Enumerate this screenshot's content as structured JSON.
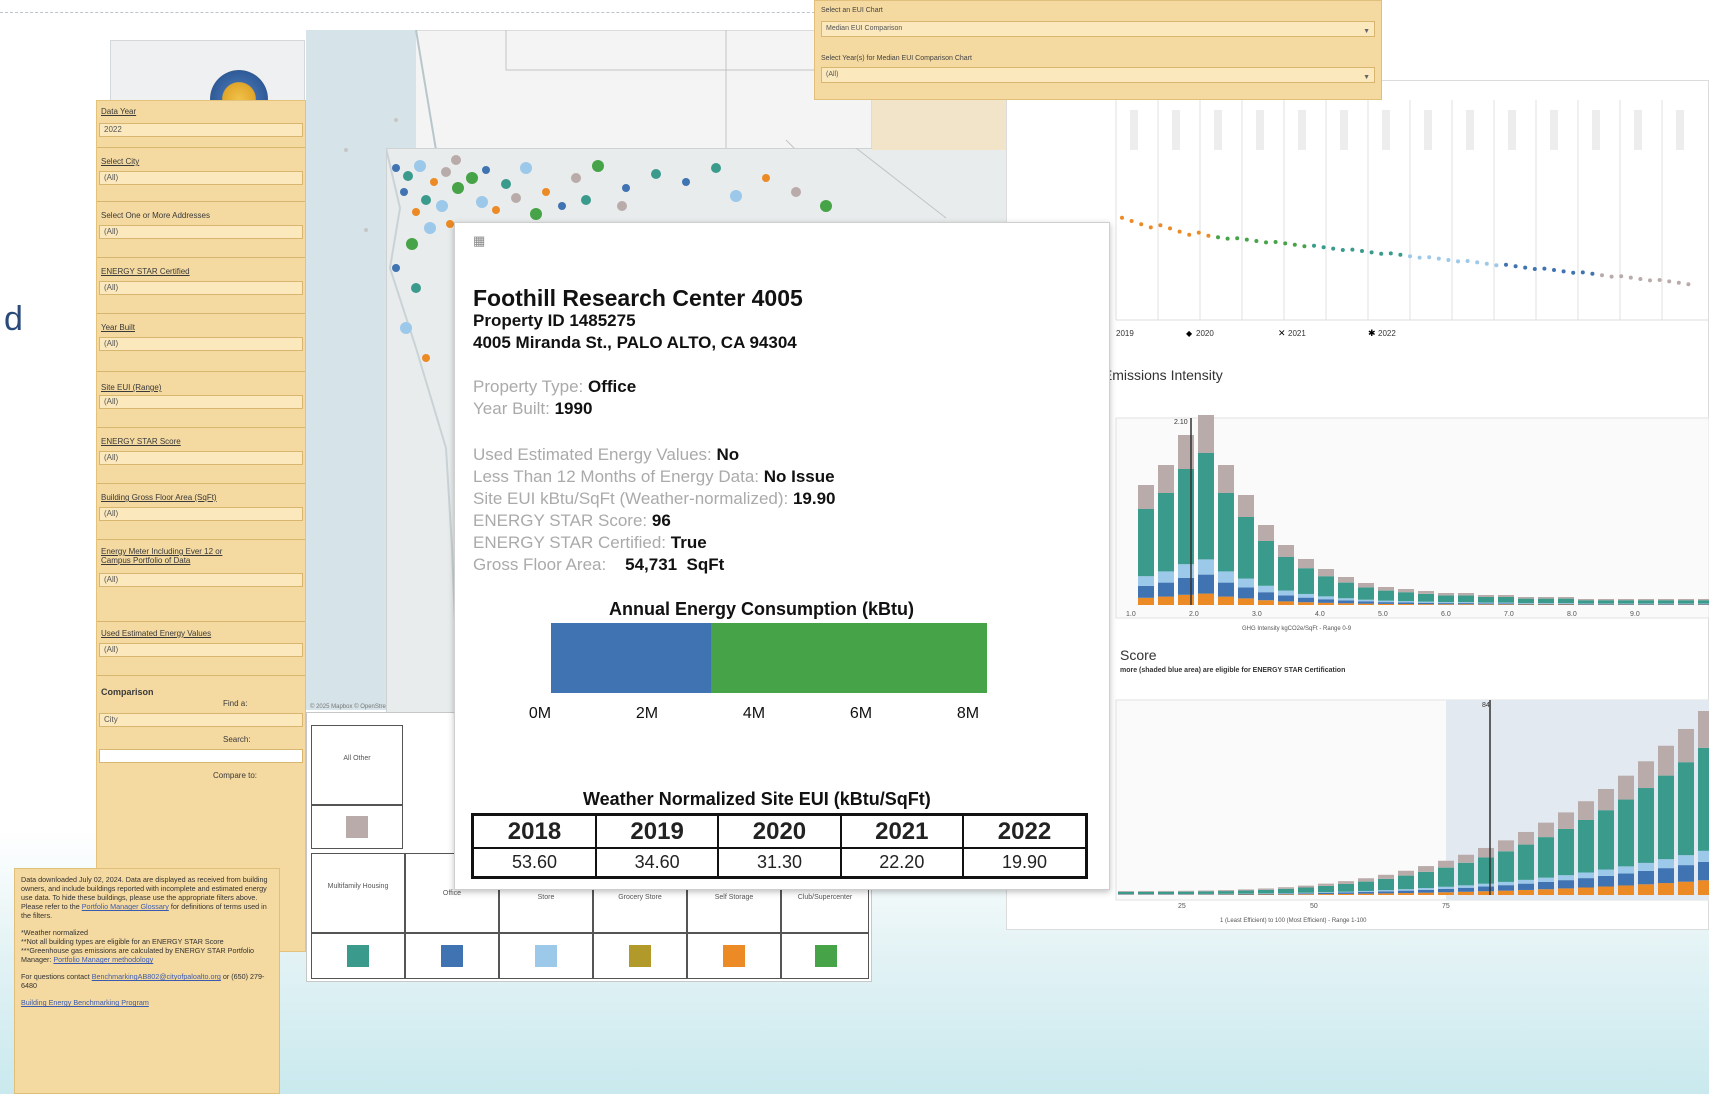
{
  "page_fragment": "d",
  "filters": {
    "items": [
      {
        "label": "Data Year",
        "value": "2022"
      },
      {
        "label": "Select City",
        "value": "(All)"
      },
      {
        "label": "Select One or More Addresses",
        "value": "(All)"
      },
      {
        "label": "ENERGY STAR Certified",
        "value": "(All)"
      },
      {
        "label": "Year Built",
        "value": "(All)"
      },
      {
        "label": "Site EUI (Range)",
        "value": "(All)"
      },
      {
        "label": "ENERGY STAR Score",
        "value": "(All)"
      },
      {
        "label": "Building Gross Floor Area (SqFt)",
        "value": "(All)"
      },
      {
        "label": "Energy Meter Including Ever 12 or Campus Portfolio of Data",
        "value": "(All)"
      },
      {
        "label": "Used Estimated Energy Values",
        "value": "(All)"
      }
    ],
    "comparison_label": "Comparison",
    "find_label": "Find a:",
    "city_value": "City",
    "search_label": "Search:",
    "compare_label": "Compare to:"
  },
  "note": {
    "p1": "Data downloaded July 02, 2024. Data are displayed as received from building owners, and include buildings reported with incomplete and estimated energy use data. To hide these buildings, please use the appropriate filters above. Please refer to the",
    "p1_link": "Portfolio Manager Glossary",
    "p1_end": "for definitions of terms used in the filters.",
    "p2": "*Weather normalized",
    "p3": "**Not all building types are eligible for an ENERGY STAR Score",
    "p4": "***Greenhouse gas emissions are calculated by ENERGY STAR Portfolio Manager:",
    "p4_link": "Portfolio Manager methodology",
    "p5": "For questions contact",
    "p5_link": "BenchmarkingAB802@cityofpaloalto.org",
    "p5_end": "or (650) 279-6480",
    "p6_link": "Building Energy Benchmarking Program"
  },
  "map": {
    "attribution": "© 2025 Mapbox © OpenStreetMap"
  },
  "legend": {
    "row1": [
      {
        "label": "All Other",
        "color": "#b9aba9"
      }
    ],
    "row2": [
      {
        "label": "Multifamily Housing",
        "color": "#3a9a8c"
      },
      {
        "label": "Office",
        "color": "#3f73b1"
      },
      {
        "label": "Store",
        "color": "#9cc8ea"
      },
      {
        "label": "Grocery Store",
        "color": "#b19a2a"
      },
      {
        "label": "Self Storage",
        "color": "#ec8a25"
      },
      {
        "label": "Club/Supercenter",
        "color": "#47a348"
      }
    ]
  },
  "dropdowns": {
    "eui_chart_label": "Select an EUI Chart",
    "eui_chart_value": "Median EUI Comparison",
    "years_label": "Select Year(s) for Median EUI Comparison Chart",
    "years_value": "(All)"
  },
  "charts": {
    "year_legend": [
      "2019",
      "2020",
      "2021",
      "2022"
    ],
    "ghg_title": "s Emissions Intensity",
    "ghg_axis": "GHG Intensity kgCO2e/SqFt - Range 0-9",
    "ghg_marker": "2.10",
    "ghg_ticks": [
      "1.0",
      "2.0",
      "3.0",
      "4.0",
      "5.0",
      "6.0",
      "7.0",
      "8.0",
      "9.0"
    ],
    "score_title": "Score",
    "score_subtitle": "more (shaded blue area) are eligible for ENERGY STAR Certification",
    "score_axis": "1 (Least Efficient) to 100 (Most Efficient) - Range 1-100",
    "score_ticks": [
      "25",
      "50",
      "75"
    ],
    "score_marker": "84"
  },
  "popup": {
    "name": "Foothill Research Center 4005",
    "property_id": "Property ID 1485275",
    "address": "4005 Miranda St., PALO ALTO, CA  94304",
    "property_type_label": "Property Type: ",
    "property_type": "Office",
    "year_built_label": "Year Built: ",
    "year_built": "1990",
    "estimated_label": "Used Estimated Energy Values:  ",
    "estimated": "No",
    "months_label": "Less Than 12 Months of Energy Data: ",
    "months": "No Issue",
    "site_eui_label": "Site EUI kBtu/SqFt (Weather-normalized): ",
    "site_eui": "19.90",
    "score_label": "ENERGY STAR Score: ",
    "score": "96",
    "certified_label": "ENERGY STAR Certified: ",
    "certified": "True",
    "gfa_label": "Gross Floor Area:    ",
    "gfa": "54,731  SqFt",
    "energy_title": "Annual Energy Consumption (kBtu)",
    "energy_ticks": [
      "0M",
      "2M",
      "4M",
      "6M",
      "8M"
    ],
    "weather_title": "Weather Normalized Site EUI (kBtu/SqFt)"
  },
  "chart_data": [
    {
      "type": "bar",
      "title": "Annual Energy Consumption (kBtu)",
      "orientation": "horizontal-stacked",
      "xlim": [
        0,
        8000000
      ],
      "series": [
        {
          "values": [
            2900000
          ]
        },
        {
          "values": [
            5000000
          ]
        }
      ],
      "colors": [
        "#3f73b1",
        "#47a348"
      ]
    },
    {
      "type": "table",
      "title": "Weather Normalized Site EUI (kBtu/SqFt)",
      "categories": [
        "2018",
        "2019",
        "2020",
        "2021",
        "2022"
      ],
      "values": [
        "53.60",
        "34.60",
        "31.30",
        "22.20",
        "19.90"
      ]
    }
  ]
}
